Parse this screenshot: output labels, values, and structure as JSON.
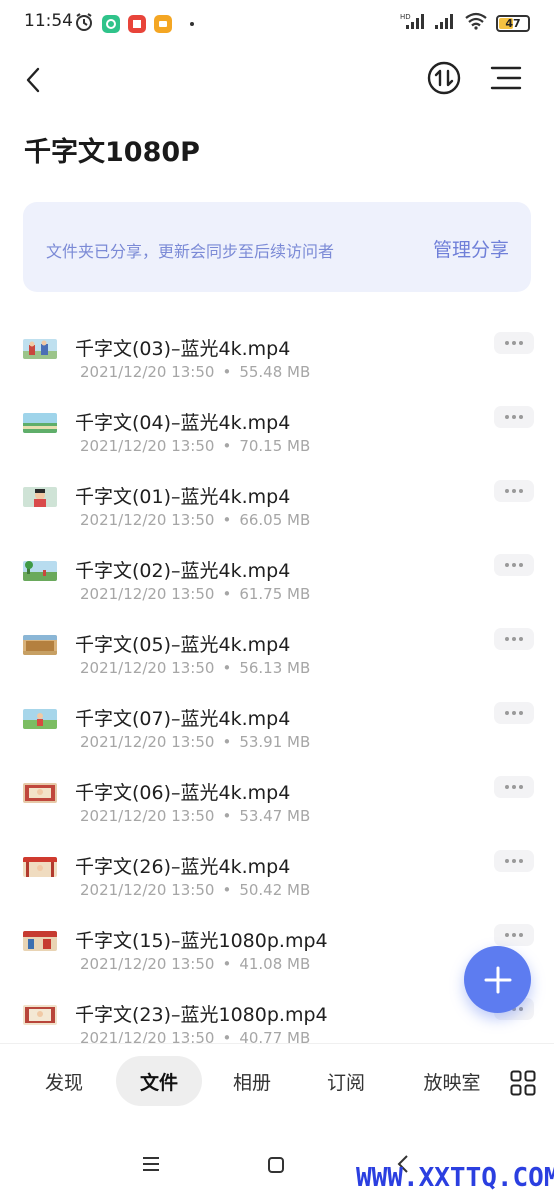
{
  "status_bar": {
    "time": "11:54",
    "battery": "47",
    "network": "HD"
  },
  "header": {
    "title": "千字文1080P"
  },
  "share_banner": {
    "text": "文件夹已分享，更新会同步至后续访问者",
    "action": "管理分享"
  },
  "files": [
    {
      "name": "千字文(03)–蓝光4k.mp4",
      "date": "2021/12/20 13:50",
      "size": "55.48 MB"
    },
    {
      "name": "千字文(04)–蓝光4k.mp4",
      "date": "2021/12/20 13:50",
      "size": "70.15 MB"
    },
    {
      "name": "千字文(01)–蓝光4k.mp4",
      "date": "2021/12/20 13:50",
      "size": "66.05 MB"
    },
    {
      "name": "千字文(02)–蓝光4k.mp4",
      "date": "2021/12/20 13:50",
      "size": "61.75 MB"
    },
    {
      "name": "千字文(05)–蓝光4k.mp4",
      "date": "2021/12/20 13:50",
      "size": "56.13 MB"
    },
    {
      "name": "千字文(07)–蓝光4k.mp4",
      "date": "2021/12/20 13:50",
      "size": "53.91 MB"
    },
    {
      "name": "千字文(06)–蓝光4k.mp4",
      "date": "2021/12/20 13:50",
      "size": "53.47 MB"
    },
    {
      "name": "千字文(26)–蓝光4k.mp4",
      "date": "2021/12/20 13:50",
      "size": "50.42 MB"
    },
    {
      "name": "千字文(15)–蓝光1080p.mp4",
      "date": "2021/12/20 13:50",
      "size": "41.08 MB"
    },
    {
      "name": "千字文(23)–蓝光1080p.mp4",
      "date": "2021/12/20 13:50",
      "size": "40.77 MB"
    }
  ],
  "meta_separator": "•",
  "tabs": [
    {
      "label": "发现"
    },
    {
      "label": "文件"
    },
    {
      "label": "相册"
    },
    {
      "label": "订阅"
    },
    {
      "label": "放映室"
    }
  ],
  "watermark": "WWW.XXTTQ.COM",
  "colors": {
    "accent": "#5d7cf0",
    "banner_bg": "#eef1fc",
    "banner_text": "#7b8ad6",
    "meta_text": "#a6a6a6"
  }
}
